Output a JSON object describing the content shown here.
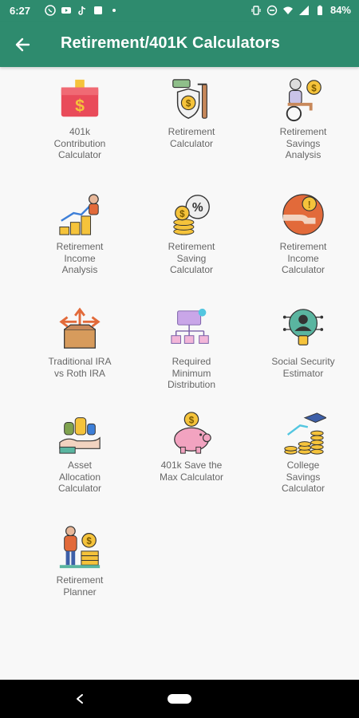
{
  "status_bar": {
    "time": "6:27",
    "battery": "84%",
    "left_icons": [
      "whatsapp-icon",
      "youtube-icon",
      "tiktok-icon",
      "app-icon",
      "dot-icon"
    ],
    "right_icons": [
      "vibrate-icon",
      "dnd-icon",
      "wifi-icon",
      "signal-icon",
      "battery-icon"
    ]
  },
  "app_bar": {
    "title": "Retirement/401K Calculators",
    "back_icon": "arrow-left-icon"
  },
  "tiles": [
    {
      "label": "401k\nContribution\nCalculator",
      "icon": "red-wallet-dollar-icon"
    },
    {
      "label": "Retirement\nCalculator",
      "icon": "shield-dollar-hand-icon"
    },
    {
      "label": "Retirement\nSavings\nAnalysis",
      "icon": "elderly-wheelchair-coin-icon"
    },
    {
      "label": "Retirement\nIncome\nAnalysis",
      "icon": "coins-growth-person-icon"
    },
    {
      "label": "Retirement\nSaving\nCalculator",
      "icon": "coins-percent-icon"
    },
    {
      "label": "Retirement\nIncome\nCalculator",
      "icon": "hand-coin-circle-icon"
    },
    {
      "label": "Traditional IRA\nvs Roth IRA",
      "icon": "box-arrows-icon"
    },
    {
      "label": "Required\nMinimum\nDistribution",
      "icon": "network-chart-icon"
    },
    {
      "label": "Social Security\nEstimator",
      "icon": "person-lock-network-icon"
    },
    {
      "label": "Asset\nAllocation\nCalculator",
      "icon": "hand-money-bags-icon"
    },
    {
      "label": "401k Save the\nMax Calculator",
      "icon": "piggy-bank-icon"
    },
    {
      "label": "College\nSavings\nCalculator",
      "icon": "graduation-coins-icon"
    },
    {
      "label": "Retirement\nPlanner",
      "icon": "person-coins-icon"
    }
  ],
  "colors": {
    "primary": "#2e8b6e",
    "background": "#f8f8f8",
    "label_text": "#666666"
  },
  "nav_bar": {
    "back_icon": "nav-back-icon",
    "home_icon": "nav-home-pill-icon"
  }
}
